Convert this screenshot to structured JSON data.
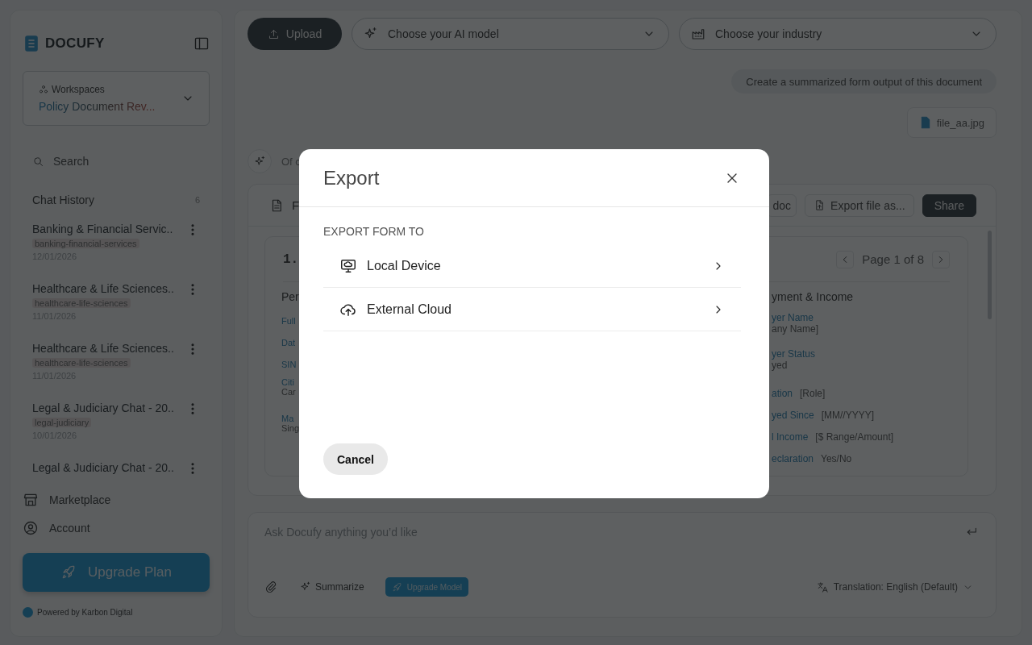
{
  "sidebar": {
    "logo": "DOCUFY",
    "workspace": {
      "label": "Workspaces",
      "value": "Policy Document Rev..."
    },
    "search": {
      "placeholder": "Search"
    },
    "chat_history": {
      "title": "Chat History",
      "count": "6",
      "items": [
        {
          "title": "Banking & Financial Servic..",
          "tag": "banking-financial-services",
          "date": "12/01/2026"
        },
        {
          "title": "Healthcare & Life Sciences..",
          "tag": "healthcare-life-sciences",
          "date": "11/01/2026"
        },
        {
          "title": "Healthcare & Life Sciences..",
          "tag": "healthcare-life-sciences",
          "date": "11/01/2026"
        },
        {
          "title": "Legal & Judiciary Chat - 20..",
          "tag": "legal-judiciary",
          "date": "10/01/2026"
        },
        {
          "title": "Legal & Judiciary Chat - 20.."
        }
      ]
    },
    "nav": [
      {
        "label": "Marketplace",
        "kind": "store"
      },
      {
        "label": "Account",
        "kind": "account"
      }
    ],
    "upgrade_button": "Upgrade Plan",
    "footer": "Powered by Karbon Digital"
  },
  "toolbar": {
    "upload": "Upload",
    "model_select": {
      "placeholder": "Choose your AI model"
    },
    "industry_select": {
      "placeholder": "Choose your industry"
    }
  },
  "chat": {
    "user_message": "Create a summarized form output of this document",
    "attachment": "file_aa.jpg",
    "reply_text": "Of c",
    "document": {
      "title": "F",
      "actions": [
        {
          "label": "doc",
          "kind": "outline"
        },
        {
          "label": "Export file as...",
          "kind": "export"
        },
        {
          "label": "Share",
          "kind": "primary"
        }
      ],
      "section": "1.",
      "pager": "Page 1 of 8",
      "left_column": {
        "heading": "Per",
        "fields": [
          {
            "label": "Full",
            "kind": "inline"
          },
          {
            "label": "Dat",
            "kind": "inline"
          },
          {
            "label": "SIN",
            "kind": "inline"
          },
          {
            "label": "Citi",
            "value": "Car",
            "kind": "stacked"
          },
          {
            "label": "Ma",
            "value": "Sing",
            "kind": "stacked"
          }
        ]
      },
      "right_column": {
        "heading": "yment & Income",
        "fields": [
          {
            "label": "yer Name",
            "value": "any Name]",
            "kind": "stacked"
          },
          {
            "label": "yer Status",
            "value": "yed",
            "kind": "stacked"
          },
          {
            "label": "ation",
            "value": "[Role]",
            "kind": "inline"
          },
          {
            "label": "yed Since",
            "value": "[MM//YYYY]",
            "kind": "inline"
          },
          {
            "label": "l Income",
            "value": "[$ Range/Amount]",
            "kind": "inline"
          },
          {
            "label": "eclaration",
            "value": "Yes/No",
            "kind": "inline"
          }
        ]
      }
    }
  },
  "composer": {
    "placeholder": "Ask Docufy anything you’d like",
    "summarize": "Summarize",
    "upgrade_model": "Upgrade Model",
    "translation": "Translation: English (Default)"
  },
  "dialog": {
    "title": "Export",
    "section": "EXPORT FORM TO",
    "options": [
      {
        "label": "Local Device",
        "kind": "device"
      },
      {
        "label": "External Cloud",
        "kind": "cloud"
      }
    ],
    "cancel": "Cancel"
  }
}
